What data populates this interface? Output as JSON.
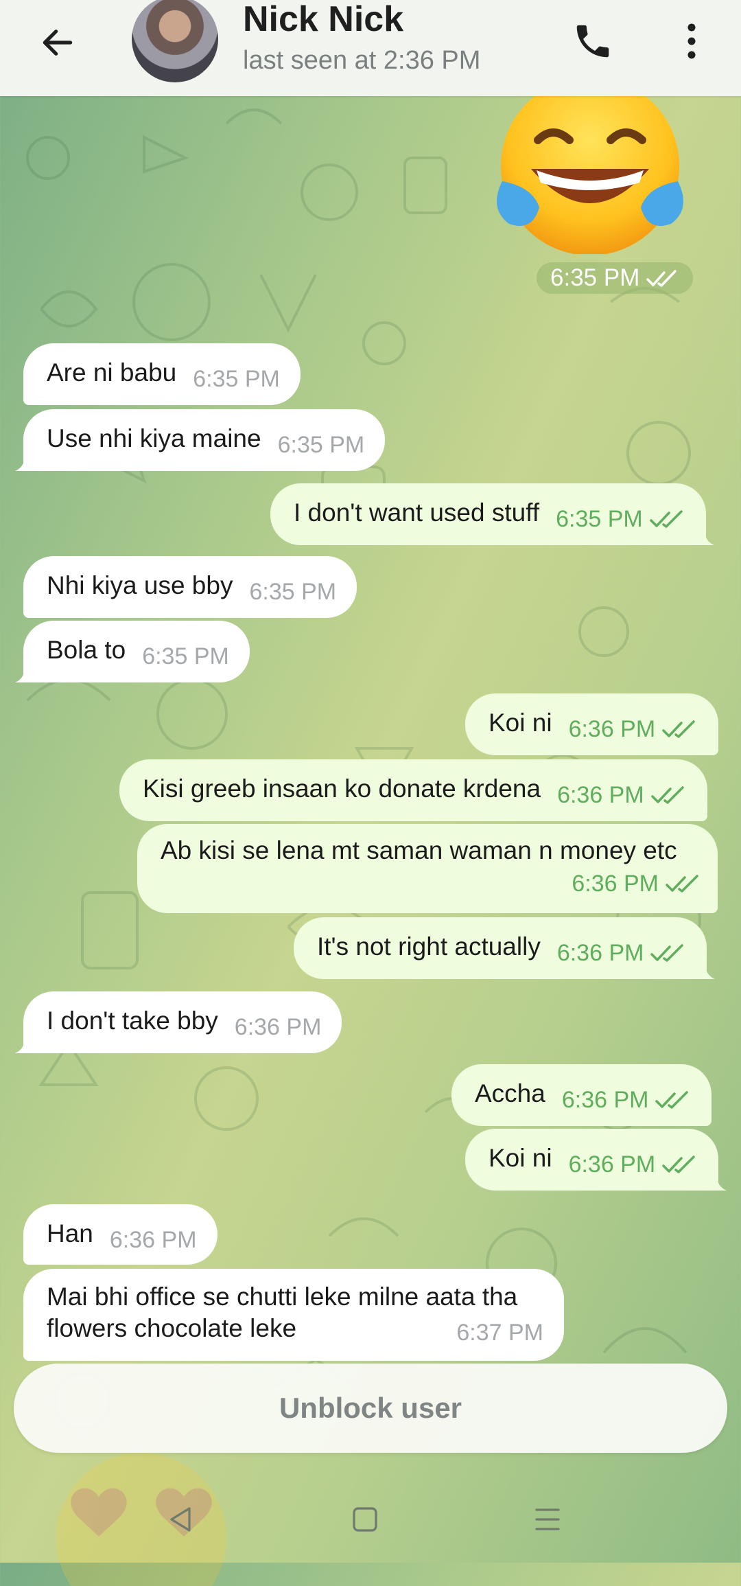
{
  "header": {
    "name": "Nick Nick",
    "status": "last seen at 2:36 PM",
    "back_icon": "arrow-left-icon",
    "call_icon": "phone-icon",
    "menu_icon": "more-vertical-icon"
  },
  "sticker": {
    "emoji": "face-with-tears-of-joy",
    "time": "6:35 PM"
  },
  "messages": [
    {
      "dir": "in",
      "text": "Are ni babu",
      "time": "6:35 PM"
    },
    {
      "dir": "in",
      "text": "Use nhi kiya maine",
      "time": "6:35 PM"
    },
    {
      "dir": "out",
      "text": "I don't want used stuff",
      "time": "6:35 PM"
    },
    {
      "dir": "in",
      "text": "Nhi kiya use bby",
      "time": "6:35 PM"
    },
    {
      "dir": "in",
      "text": "Bola to",
      "time": "6:35 PM"
    },
    {
      "dir": "out",
      "text": "Koi ni",
      "time": "6:36 PM"
    },
    {
      "dir": "out",
      "text": "Kisi greeb insaan ko donate krdena",
      "time": "6:36 PM"
    },
    {
      "dir": "out",
      "text": "Ab kisi se lena mt saman waman n money etc",
      "time": "6:36 PM"
    },
    {
      "dir": "out",
      "text": "It's not right actually",
      "time": "6:36 PM"
    },
    {
      "dir": "in",
      "text": "I don't take bby",
      "time": "6:36 PM"
    },
    {
      "dir": "out",
      "text": "Accha",
      "time": "6:36 PM"
    },
    {
      "dir": "out",
      "text": "Koi ni",
      "time": "6:36 PM"
    },
    {
      "dir": "in",
      "text": "Han",
      "time": "6:36 PM"
    },
    {
      "dir": "in",
      "text_line1": "Mai bhi office se chutti leke milne aata tha",
      "text_line2": "flowers chocolate leke",
      "time": "6:37 PM"
    }
  ],
  "unblock_label": "Unblock user",
  "nav": {
    "back": "nav-back-icon",
    "home": "nav-home-icon",
    "recents": "nav-recents-icon"
  },
  "colors": {
    "incoming": "#ffffff",
    "outgoing": "#effdde",
    "tick": "#5fad5d",
    "header": "#f1f4ef"
  }
}
